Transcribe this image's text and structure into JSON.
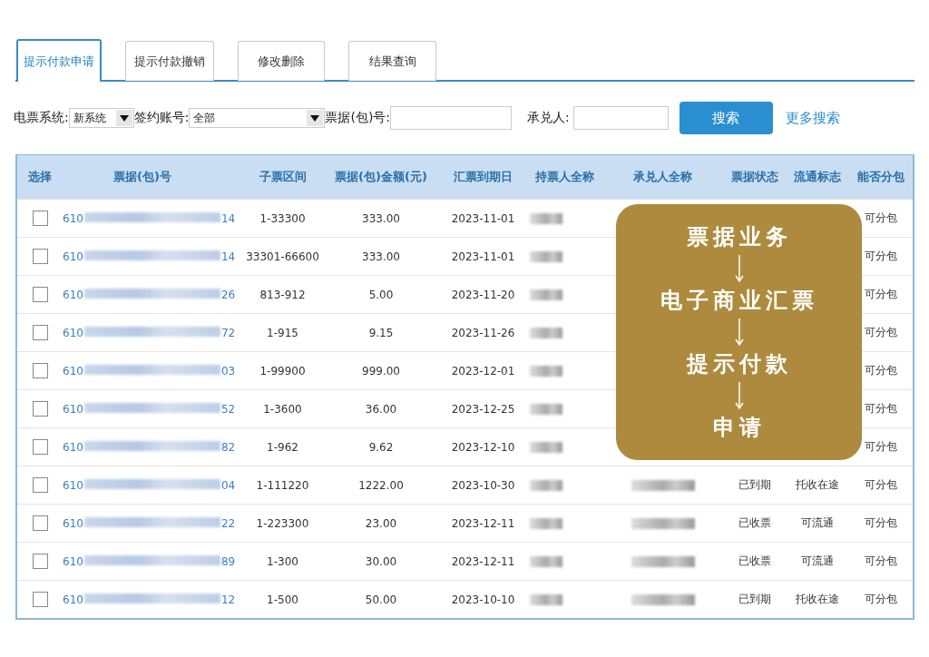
{
  "tabs": [
    {
      "label": "提示付款申请",
      "selected": true
    },
    {
      "label": "提示付款撤销",
      "selected": false
    },
    {
      "label": "修改删除",
      "selected": false
    },
    {
      "label": "结果查询",
      "selected": false
    }
  ],
  "search": {
    "system_label": "电票系统:",
    "system_value": "新系统",
    "account_label": "签约账号:",
    "account_value": "全部",
    "bill_no_label": "票据(包)号:",
    "acceptor_label": "承兑人:",
    "search_button": "搜索",
    "more_link": "更多搜索"
  },
  "table": {
    "columns": [
      "选择",
      "票据(包)号",
      "子票区间",
      "票据(包)金额(元)",
      "汇票到期日",
      "持票人全称",
      "承兑人全称",
      "票据状态",
      "流通标志",
      "能否分包"
    ],
    "rows": [
      {
        "checked": false,
        "bill_prefix": "610",
        "bill_suffix": "14",
        "range": "1-33300",
        "amount": "333.00",
        "due": "2023-11-01",
        "split": "可分包"
      },
      {
        "checked": false,
        "bill_prefix": "610",
        "bill_suffix": "14",
        "range": "33301-66600",
        "amount": "333.00",
        "due": "2023-11-01",
        "split": "可分包"
      },
      {
        "checked": false,
        "bill_prefix": "610",
        "bill_suffix": "26",
        "range": "813-912",
        "amount": "5.00",
        "due": "2023-11-20",
        "split": "可分包"
      },
      {
        "checked": false,
        "bill_prefix": "610",
        "bill_suffix": "72",
        "range": "1-915",
        "amount": "9.15",
        "due": "2023-11-26",
        "split": "可分包"
      },
      {
        "checked": false,
        "bill_prefix": "610",
        "bill_suffix": "03",
        "range": "1-99900",
        "amount": "999.00",
        "due": "2023-12-01",
        "split": "可分包"
      },
      {
        "checked": false,
        "bill_prefix": "610",
        "bill_suffix": "52",
        "range": "1-3600",
        "amount": "36.00",
        "due": "2023-12-25",
        "split": "可分包"
      },
      {
        "checked": false,
        "bill_prefix": "610",
        "bill_suffix": "82",
        "range": "1-962",
        "amount": "9.62",
        "due": "2023-12-10",
        "split": "可分包"
      },
      {
        "checked": false,
        "bill_prefix": "610",
        "bill_suffix": "04",
        "range": "1-111220",
        "amount": "1222.00",
        "due": "2023-10-30",
        "status": "已到期",
        "flag": "托收在途",
        "split": "可分包"
      },
      {
        "checked": false,
        "bill_prefix": "610",
        "bill_suffix": "22",
        "range": "1-223300",
        "amount": "23.00",
        "due": "2023-12-11",
        "status": "已收票",
        "flag": "可流通",
        "split": "可分包"
      },
      {
        "checked": false,
        "bill_prefix": "610",
        "bill_suffix": "89",
        "range": "1-300",
        "amount": "30.00",
        "due": "2023-12-11",
        "status": "已收票",
        "flag": "可流通",
        "split": "可分包"
      },
      {
        "checked": false,
        "bill_prefix": "610",
        "bill_suffix": "12",
        "range": "1-500",
        "amount": "50.00",
        "due": "2023-10-10",
        "status": "已到期",
        "flag": "托收在途",
        "split": "可分包"
      }
    ]
  },
  "callout": {
    "steps": [
      "票据业务",
      "电子商业汇票",
      "提示付款",
      "申请"
    ]
  }
}
